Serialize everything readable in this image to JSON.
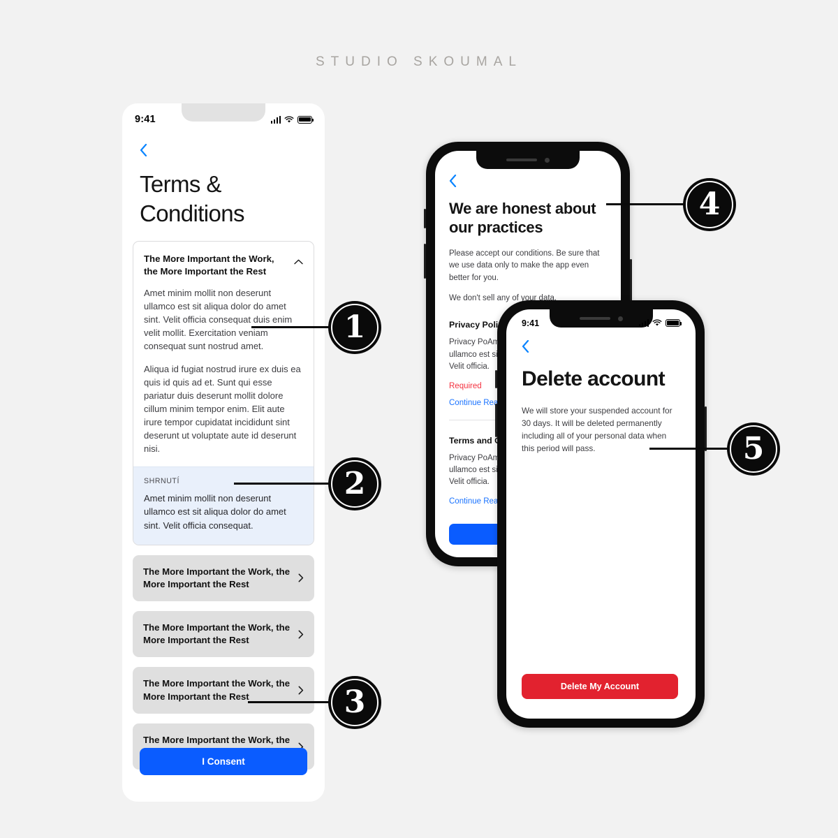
{
  "brand": {
    "title": "STUDIO SKOUMAL"
  },
  "colors": {
    "page_background": "#f2f2f2",
    "accent_blue": "#0a5cff",
    "link_blue": "#1a73ff",
    "danger_red": "#e2222f",
    "required_red": "#f4313f",
    "summary_background": "#e9f0fb",
    "row_background": "#dfdfdf",
    "badge_black": "#0a0a0a",
    "brand_gray": "#a8a5a1"
  },
  "phone1": {
    "status_bar": {
      "time": "9:41",
      "icons": [
        "signal-bars-icon",
        "wifi-icon",
        "battery-icon"
      ]
    },
    "back_icon": "back-chevron-icon",
    "title": "Terms & Conditions",
    "accordion_open": {
      "heading": "The More Important the Work, the More Important the Rest",
      "toggle_icon": "chevron-up-icon",
      "paragraphs": [
        "Amet minim mollit non deserunt ullamco est sit aliqua dolor do amet sint. Velit officia consequat duis enim velit mollit. Exercitation veniam consequat sunt nostrud amet.",
        "Aliqua id fugiat nostrud irure ex duis ea quis id quis ad et. Sunt qui esse pariatur duis deserunt mollit dolore cillum minim tempor enim. Elit aute irure tempor cupidatat incididunt sint deserunt ut voluptate aute id deserunt nisi."
      ],
      "summary_label": "SHRNUTÍ",
      "summary_text": "Amet minim mollit non deserunt ullamco est sit aliqua dolor do amet sint. Velit officia consequat."
    },
    "collapsed_rows": [
      {
        "label": "The More Important the Work, the More Important the Rest",
        "icon": "chevron-right-icon"
      },
      {
        "label": "The More Important the Work, the More Important the Rest",
        "icon": "chevron-right-icon"
      },
      {
        "label": "The More Important the Work, the More Important the Rest",
        "icon": "chevron-right-icon"
      },
      {
        "label": "The More Important the Work, the More Important the Rest",
        "icon": "chevron-right-icon"
      }
    ],
    "primary_button": "I Consent"
  },
  "phone2": {
    "back_icon": "back-chevron-icon",
    "title": "We are honest about our practices",
    "intro_paragraphs": [
      "Please accept our conditions. Be sure that we use data only to make the app even better for you.",
      "We don't sell any of your data."
    ],
    "sections": [
      {
        "heading": "Privacy Policy",
        "body": "Privacy PoAmet minim mollit non deserunt ullamco est sit aliqua dolor do amet sint. Velit officia.",
        "required_label": "Required",
        "link_label": "Continue Reading"
      },
      {
        "heading": "Terms and Conditions",
        "body": "Privacy PoAmet minim mollit non deserunt ullamco est sit aliqua dolor do amet sint. Velit officia.",
        "link_label": "Continue Reading"
      }
    ],
    "primary_button": ""
  },
  "phone3": {
    "status_bar": {
      "time": "9:41",
      "icons": [
        "signal-bars-icon",
        "wifi-icon",
        "battery-icon"
      ]
    },
    "back_icon": "back-chevron-icon",
    "title": "Delete account",
    "body": "We will store your suspended account for 30 days. It will be deleted permanently including all of your personal data when this period will pass.",
    "danger_button": "Delete My Account"
  },
  "callouts": [
    {
      "number": "1"
    },
    {
      "number": "2"
    },
    {
      "number": "3"
    },
    {
      "number": "4"
    },
    {
      "number": "5"
    }
  ]
}
